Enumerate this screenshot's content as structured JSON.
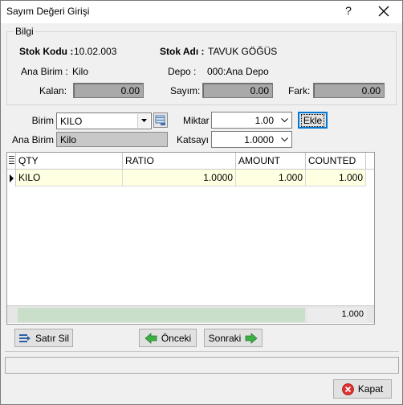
{
  "window": {
    "title": "Sayım Değeri Girişi",
    "help_glyph": "?",
    "close_icon": "close-icon"
  },
  "bilgi": {
    "legend": "Bilgi",
    "stok_kodu_label": "Stok Kodu :",
    "stok_kodu_value": "10.02.003",
    "stok_adi_label": "Stok Adı :",
    "stok_adi_value": "TAVUK GÖĞÜS",
    "ana_birim_label": "Ana Birim :",
    "ana_birim_value": "Kilo",
    "depo_label": "Depo :",
    "depo_value": "000:Ana Depo",
    "kalan_label": "Kalan:",
    "kalan_value": "0.00",
    "sayim_label": "Sayım:",
    "sayim_value": "0.00",
    "fark_label": "Fark:",
    "fark_value": "0.00"
  },
  "entry": {
    "birim_label": "Birim",
    "birim_value": "KILO",
    "ana_birim_label": "Ana Birim",
    "ana_birim_value": "Kilo",
    "miktar_label": "Miktar",
    "miktar_value": "1.00",
    "katsayi_label": "Katsayı",
    "katsayi_value": "1.0000",
    "ekle_label": "Ekle"
  },
  "grid": {
    "columns": [
      "QTY",
      "RATIO",
      "AMOUNT",
      "COUNTED"
    ],
    "rows": [
      {
        "qty": "KILO",
        "ratio": "1.0000",
        "amount": "1.000",
        "counted": "1.000"
      }
    ],
    "footer_total": "1.000"
  },
  "buttons": {
    "satir_sil": "Satır Sil",
    "onceki": "Önceki",
    "sonraki": "Sonraki",
    "kapat": "Kapat"
  },
  "colors": {
    "readonly_field": "#a9a9a9",
    "row_highlight": "#ffffe1",
    "footer_green": "#c9dfc9",
    "focus_border": "#0078d7"
  }
}
